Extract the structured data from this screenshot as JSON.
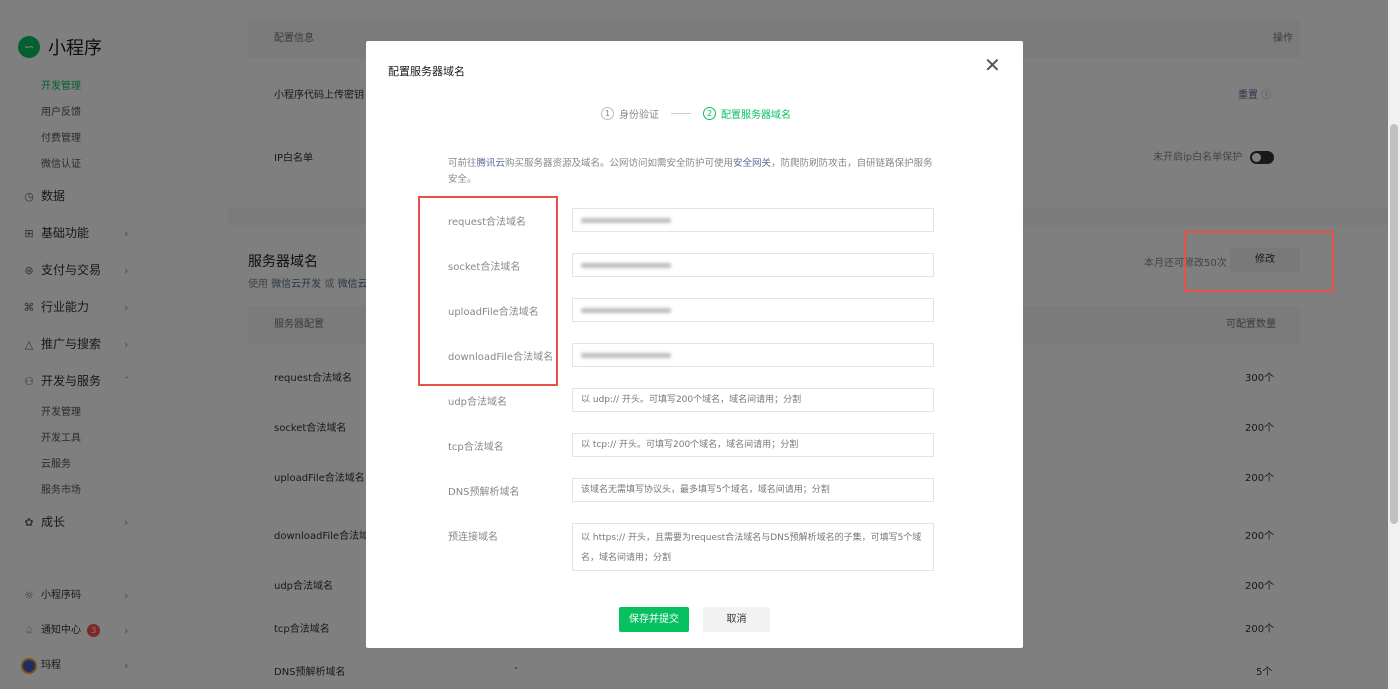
{
  "sidebar": {
    "logo_text": "小程序",
    "logo_icon": "mini-program-icon",
    "top_items": [
      "开发管理",
      "用户反馈",
      "付费管理",
      "微信认证"
    ],
    "main_items": [
      {
        "label": "数据",
        "icon": "clock-icon"
      },
      {
        "label": "基础功能",
        "icon": "grid-icon"
      },
      {
        "label": "支付与交易",
        "icon": "currency-icon"
      },
      {
        "label": "行业能力",
        "icon": "industry-icon"
      },
      {
        "label": "推广与搜索",
        "icon": "promote-icon"
      },
      {
        "label": "开发与服务",
        "icon": "dev-icon"
      }
    ],
    "dev_sub_items": [
      "开发管理",
      "开发工具",
      "云服务",
      "服务市场"
    ],
    "growth_label": "成长",
    "bottom_items": [
      {
        "label": "小程序码",
        "icon": "qrcode-icon"
      },
      {
        "label": "通知中心",
        "icon": "bell-icon",
        "badge": "3"
      },
      {
        "label": "玛程",
        "icon": "avatar"
      }
    ]
  },
  "background": {
    "config_header": "配置信息",
    "action_header": "操作",
    "upload_key_label": "小程序代码上传密钥",
    "reset_label": "重置",
    "ip_whitelist_label": "IP白名单",
    "ip_whitelist_status": "未开启ip白名单保护",
    "server_domain_title": "服务器域名",
    "server_domain_desc_prefix": "使用",
    "cloud_dev_link": "微信云开发",
    "or_text": "或",
    "cloud_link2": "微信云",
    "modify_quota": "本月还可修改50次",
    "modify_button": "修改",
    "table_header_config": "服务器配置",
    "table_header_count": "可配置数量",
    "rows": [
      {
        "label": "request合法域名",
        "count": "300个"
      },
      {
        "label": "socket合法域名",
        "count": "200个"
      },
      {
        "label": "uploadFile合法域名",
        "count": "200个"
      },
      {
        "label": "downloadFile合法域名",
        "count": "200个"
      },
      {
        "label": "udp合法域名",
        "count": "200个"
      },
      {
        "label": "tcp合法域名",
        "count": "200个"
      },
      {
        "label": "DNS预解析域名",
        "count": "5个",
        "value": "-"
      }
    ]
  },
  "modal": {
    "title": "配置服务器域名",
    "steps": [
      {
        "num": "1",
        "label": "身份验证"
      },
      {
        "num": "2",
        "label": "配置服务器域名"
      }
    ],
    "intro_1": "可前往",
    "intro_link1": "腾讯云",
    "intro_2": "购买服务器资源及域名。公网访问如需安全防护可使用",
    "intro_link2": "安全网关",
    "intro_3": "，防爬防刷防攻击，自研链路保护服务安全。",
    "fields": [
      {
        "label": "request合法域名"
      },
      {
        "label": "socket合法域名"
      },
      {
        "label": "uploadFile合法域名"
      },
      {
        "label": "downloadFile合法域名"
      },
      {
        "label": "udp合法域名",
        "placeholder": "以 udp:// 开头。可填写200个域名，域名间请用；分割"
      },
      {
        "label": "tcp合法域名",
        "placeholder": "以 tcp:// 开头。可填写200个域名，域名间请用；分割"
      },
      {
        "label": "DNS预解析域名",
        "placeholder": "该域名无需填写协议头，最多填写5个域名，域名间请用；分割"
      },
      {
        "label": "预连接域名",
        "placeholder": "以 https:// 开头，且需要为request合法域名与DNS预解析域名的子集，可填写5个域名，域名间请用；分割"
      }
    ],
    "save_button": "保存并提交",
    "cancel_button": "取消"
  },
  "colors": {
    "accent": "#07c160",
    "link": "#576b95",
    "highlight_box": "#e8504a"
  }
}
